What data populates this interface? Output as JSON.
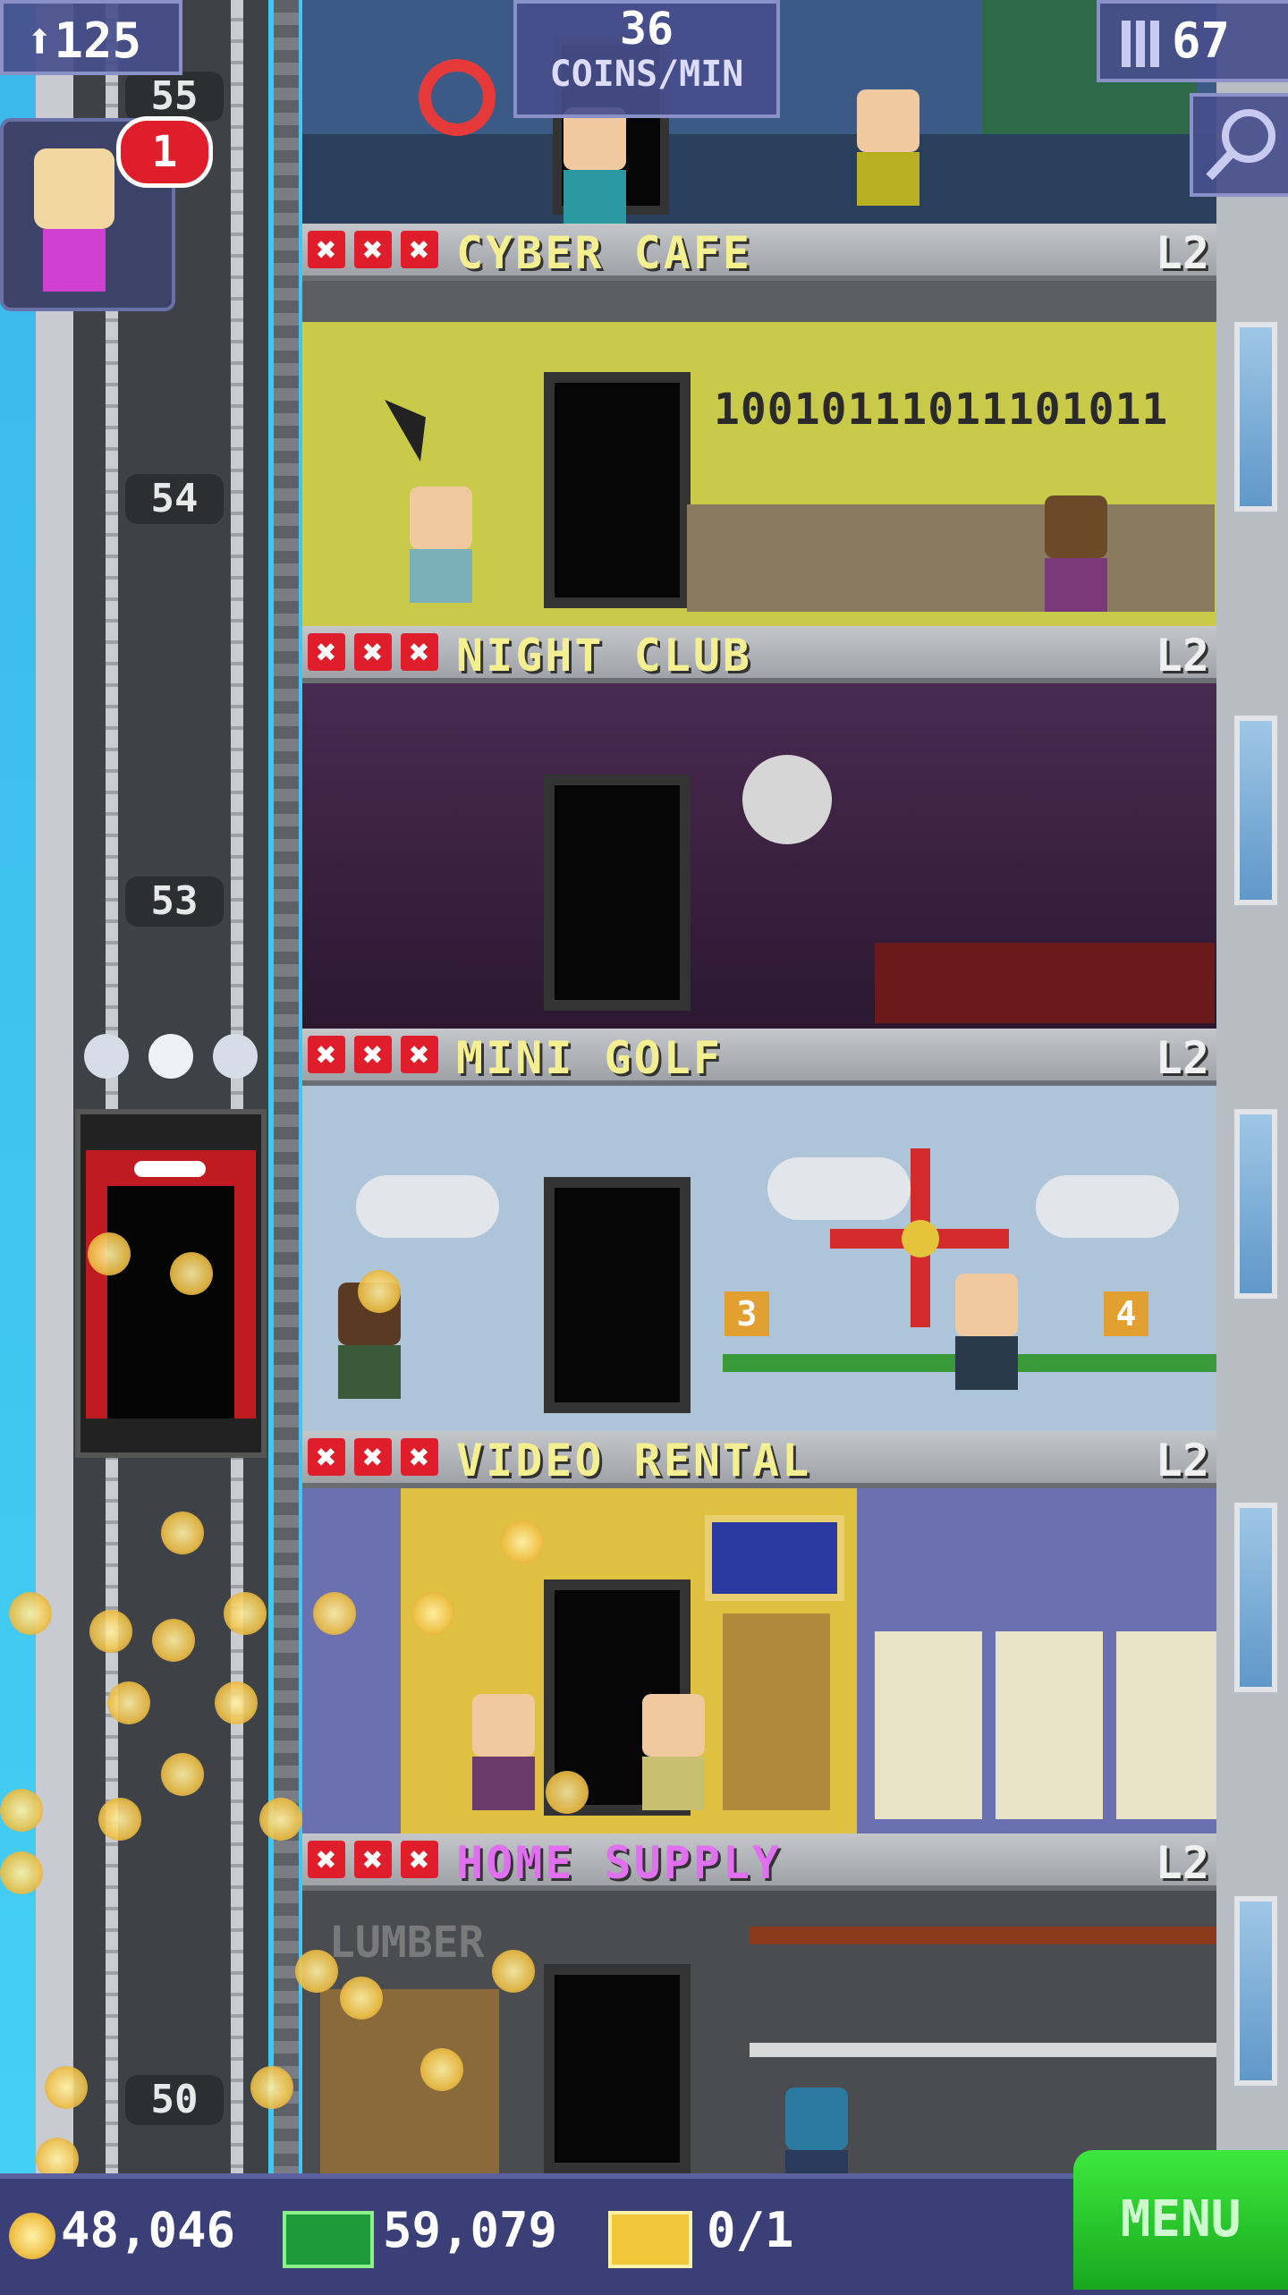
{
  "hud": {
    "population": "125",
    "coin_rate_value": "36",
    "coin_rate_label": "COINS/MIN",
    "floor_count": "67",
    "notification_count": "1"
  },
  "elevator": {
    "floor_labels": [
      "55",
      "54",
      "53",
      "50"
    ]
  },
  "floors": [
    {
      "name": "CYBER CAFE",
      "level": "L2",
      "name_color": "#F4F092",
      "decor_text": "10010111011101011"
    },
    {
      "name": "NIGHT CLUB",
      "level": "L2",
      "name_color": "#F4F092"
    },
    {
      "name": "MINI GOLF",
      "level": "L2",
      "name_color": "#F4F092",
      "hole_a": "3",
      "hole_b": "4"
    },
    {
      "name": "VIDEO RENTAL",
      "level": "L2",
      "name_color": "#F4F092"
    },
    {
      "name": "HOME SUPPLY",
      "level": "L2",
      "name_color": "#E070F0",
      "decor_text": "LUMBER"
    }
  ],
  "bottom_bar": {
    "coins": "48,046",
    "bux": "59,079",
    "tickets": "0/1",
    "menu_label": "MENU"
  },
  "icons": [
    "person-up-icon",
    "building-icon",
    "magnifier-icon",
    "coin-icon",
    "bux-icon",
    "ticket-icon"
  ]
}
